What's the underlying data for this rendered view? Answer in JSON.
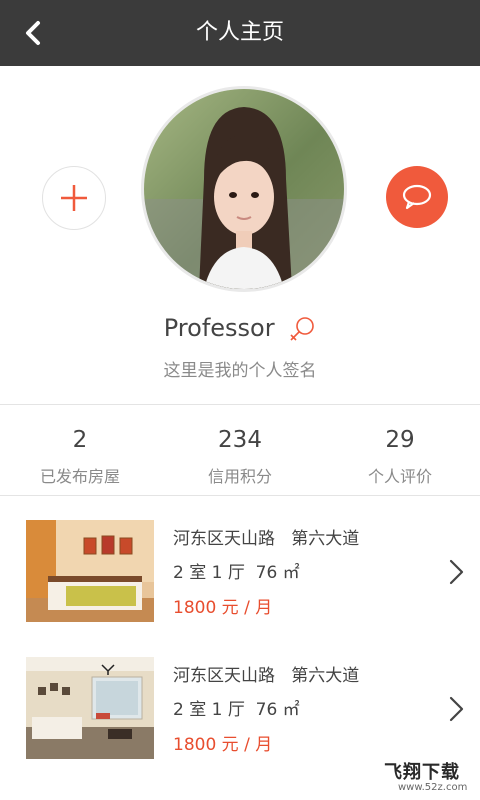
{
  "header": {
    "title": "个人主页"
  },
  "profile": {
    "name": "Professor",
    "signature": "这里是我的个人签名"
  },
  "stats": [
    {
      "value": "2",
      "label": "已发布房屋"
    },
    {
      "value": "234",
      "label": "信用积分"
    },
    {
      "value": "29",
      "label": "个人评价"
    }
  ],
  "listings": [
    {
      "address": "河东区天山路   第六大道",
      "rooms": "2 室 1 厅  76 ㎡",
      "price": "1800 元 / 月"
    },
    {
      "address": "河东区天山路   第六大道",
      "rooms": "2 室 1 厅  76 ㎡",
      "price": "1800 元 / 月"
    }
  ],
  "watermark": {
    "main": "飞翔下载",
    "sub": "www.52z.com"
  },
  "colors": {
    "accent": "#f05a3c",
    "topbar": "#3b3b3b"
  }
}
